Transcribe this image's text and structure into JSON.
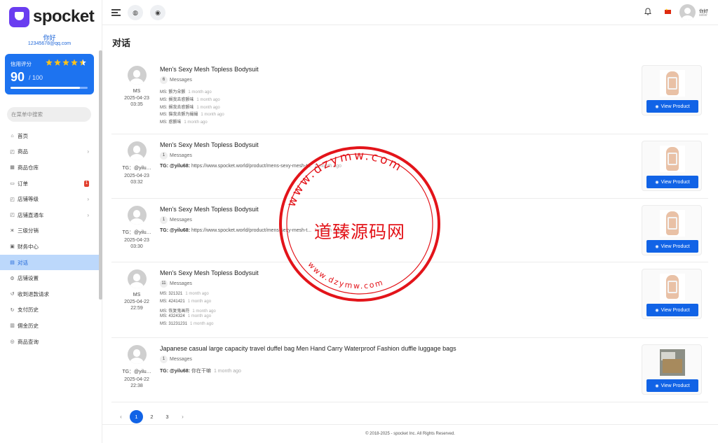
{
  "app": {
    "logo_text": "spocket"
  },
  "user": {
    "greeting": "你好",
    "email": "12345678@qq.com",
    "name": "你好",
    "role": "seller"
  },
  "credit": {
    "label": "信用评分",
    "stars": "★★★★★",
    "rating": 4.5,
    "score": "90",
    "max": "/ 100",
    "progress": 0.9,
    "star_color": "#ffc21a",
    "card_color": "#1d73f0"
  },
  "sidebar": {
    "search_placeholder": "在菜单中搜索",
    "items": [
      {
        "label": "首页",
        "icon": "home-icon",
        "glyph": "⌂",
        "chevron": false
      },
      {
        "label": "商品",
        "icon": "bag-icon",
        "glyph": "◰",
        "chevron": true
      },
      {
        "label": "商品仓库",
        "icon": "warehouse-icon",
        "glyph": "▦",
        "chevron": false
      },
      {
        "label": "订单",
        "icon": "order-icon",
        "glyph": "▭",
        "badge": "1"
      },
      {
        "label": "店铺等级",
        "icon": "level-icon",
        "glyph": "◰",
        "chevron": true
      },
      {
        "label": "店铺直通车",
        "icon": "promo-icon",
        "glyph": "◰",
        "chevron": true
      },
      {
        "label": "三级分销",
        "icon": "distribution-icon",
        "glyph": "ж",
        "chevron": false
      },
      {
        "label": "财务中心",
        "icon": "finance-icon",
        "glyph": "▣",
        "chevron": false
      },
      {
        "label": "对话",
        "icon": "chat-icon",
        "glyph": "▤",
        "active": true
      },
      {
        "label": "店铺设置",
        "icon": "settings-icon",
        "glyph": "⚙",
        "chevron": false
      },
      {
        "label": "收到退款请求",
        "icon": "refund-icon",
        "glyph": "↺",
        "chevron": false
      },
      {
        "label": "支付历史",
        "icon": "payment-history-icon",
        "glyph": "↻",
        "chevron": false
      },
      {
        "label": "佣金历史",
        "icon": "commission-icon",
        "glyph": "▥",
        "chevron": false
      },
      {
        "label": "商品查询",
        "icon": "query-icon",
        "glyph": "◎",
        "chevron": false
      }
    ]
  },
  "topbar": {
    "globe_glyph": "◍",
    "support_glyph": "◉",
    "bell_glyph": "🔔"
  },
  "page": {
    "title": "对话"
  },
  "conversations": [
    {
      "sender": "MS",
      "date": "2025-04-23",
      "time": "03:35",
      "title": "Men's Sexy Mesh Topless Bodysuit",
      "count": "6",
      "count_label": "Messages",
      "lines": [
        {
          "who": "MS:",
          "text": "颤为朵颤",
          "when": "1 month ago"
        },
        {
          "who": "MS:",
          "text": "搁我去惑颤味",
          "when": "1 month ago"
        },
        {
          "who": "MS:",
          "text": "搁我去惑颤味",
          "when": "1 month ago"
        },
        {
          "who": "MS:",
          "text": "猫我去颤为撮撮",
          "when": "1 month ago"
        },
        {
          "who": "MS:",
          "text": "惑颤味",
          "when": "1 month ago"
        }
      ],
      "thumb": "bodysuit",
      "button": "View Product"
    },
    {
      "sender": "TG：@yilu…",
      "date": "2025-04-23",
      "time": "03:32",
      "title": "Men's Sexy Mesh Topless Bodysuit",
      "count": "1",
      "count_label": "Messages",
      "lines": [
        {
          "who": "TG: @yilu68:",
          "text": "https://www.spocket.world/product/mens-sexy-mesh-t...",
          "when": "1 month ago",
          "tg": true
        }
      ],
      "thumb": "bodysuit",
      "button": "View Product"
    },
    {
      "sender": "TG：@yilu…",
      "date": "2025-04-23",
      "time": "03:30",
      "title": "Men's Sexy Mesh Topless Bodysuit",
      "count": "1",
      "count_label": "Messages",
      "lines": [
        {
          "who": "TG: @yilu68:",
          "text": "https://www.spocket.world/product/mens-sexy-mesh-t...",
          "when": "1 month ago",
          "tg": true
        }
      ],
      "thumb": "bodysuit",
      "button": "View Product"
    },
    {
      "sender": "MS",
      "date": "2025-04-22",
      "time": "22:59",
      "title": "Men's Sexy Mesh Topless Bodysuit",
      "count": "11",
      "count_label": "Messages",
      "lines": [
        {
          "who": "MS:",
          "text": "321321",
          "when": "1 month ago"
        },
        {
          "who": "MS:",
          "text": "4241421",
          "when": "1 month ago"
        },
        {
          "who": "MS:",
          "text": "恢复鬼画符",
          "when": "1 month ago"
        },
        {
          "who": "MS:",
          "text": "4324324",
          "when": "1 month ago"
        },
        {
          "who": "MS:",
          "text": "31231231",
          "when": "1 month ago"
        }
      ],
      "thumb": "bodysuit",
      "button": "View Product"
    },
    {
      "sender": "TG：@yilu…",
      "date": "2025-04-22",
      "time": "22:38",
      "title": "Japanese casual large capacity travel duffel bag Men Hand Carry Waterproof Fashion duffle luggage bags",
      "count": "1",
      "count_label": "Messages",
      "lines": [
        {
          "who": "TG: @yilu68:",
          "text": "你在干嘛",
          "when": "1 month ago",
          "tg": true
        }
      ],
      "thumb": "bag",
      "button": "View Product"
    }
  ],
  "pagination": {
    "prev": "‹",
    "pages": [
      "1",
      "2",
      "3"
    ],
    "current": "1",
    "next": "›",
    "active_color": "#1163e6"
  },
  "footer": {
    "text": "© 2018-2025 - spocket Inc. All Rights Reserved."
  },
  "watermark": {
    "center_text": "道臻源码网",
    "ring_text": "www.dzymw.com",
    "color": "#e3141a"
  }
}
